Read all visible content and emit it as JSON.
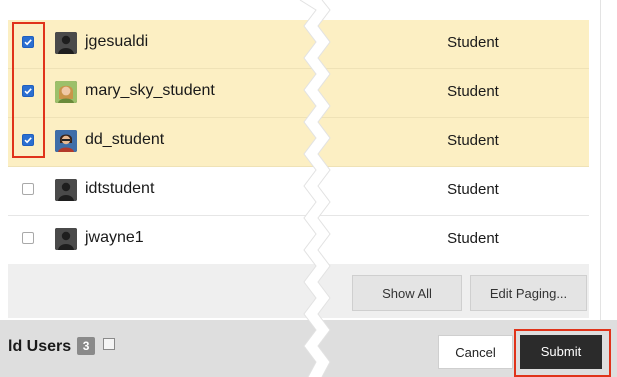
{
  "users": [
    {
      "username": "jgesualdi",
      "role": "Student",
      "checked": true,
      "avatar": "default-avatar-icon"
    },
    {
      "username": "mary_sky_student",
      "role": "Student",
      "checked": true,
      "avatar": "photo-avatar-icon"
    },
    {
      "username": "dd_student",
      "role": "Student",
      "checked": true,
      "avatar": "photo-avatar-icon"
    },
    {
      "username": "idtstudent",
      "role": "Student",
      "checked": false,
      "avatar": "default-avatar-icon"
    },
    {
      "username": "jwayne1",
      "role": "Student",
      "checked": false,
      "avatar": "default-avatar-icon"
    }
  ],
  "paging": {
    "show_all_label": "Show All",
    "edit_paging_label": "Edit Paging..."
  },
  "footer": {
    "title": "ld Users",
    "count": "3",
    "cancel_label": "Cancel",
    "submit_label": "Submit"
  },
  "colors": {
    "selected_row": "#fcefc3",
    "checkbox_checked": "#2b6fd1",
    "highlight_box": "#e0331a",
    "submit_bg": "#2b2b2b"
  }
}
